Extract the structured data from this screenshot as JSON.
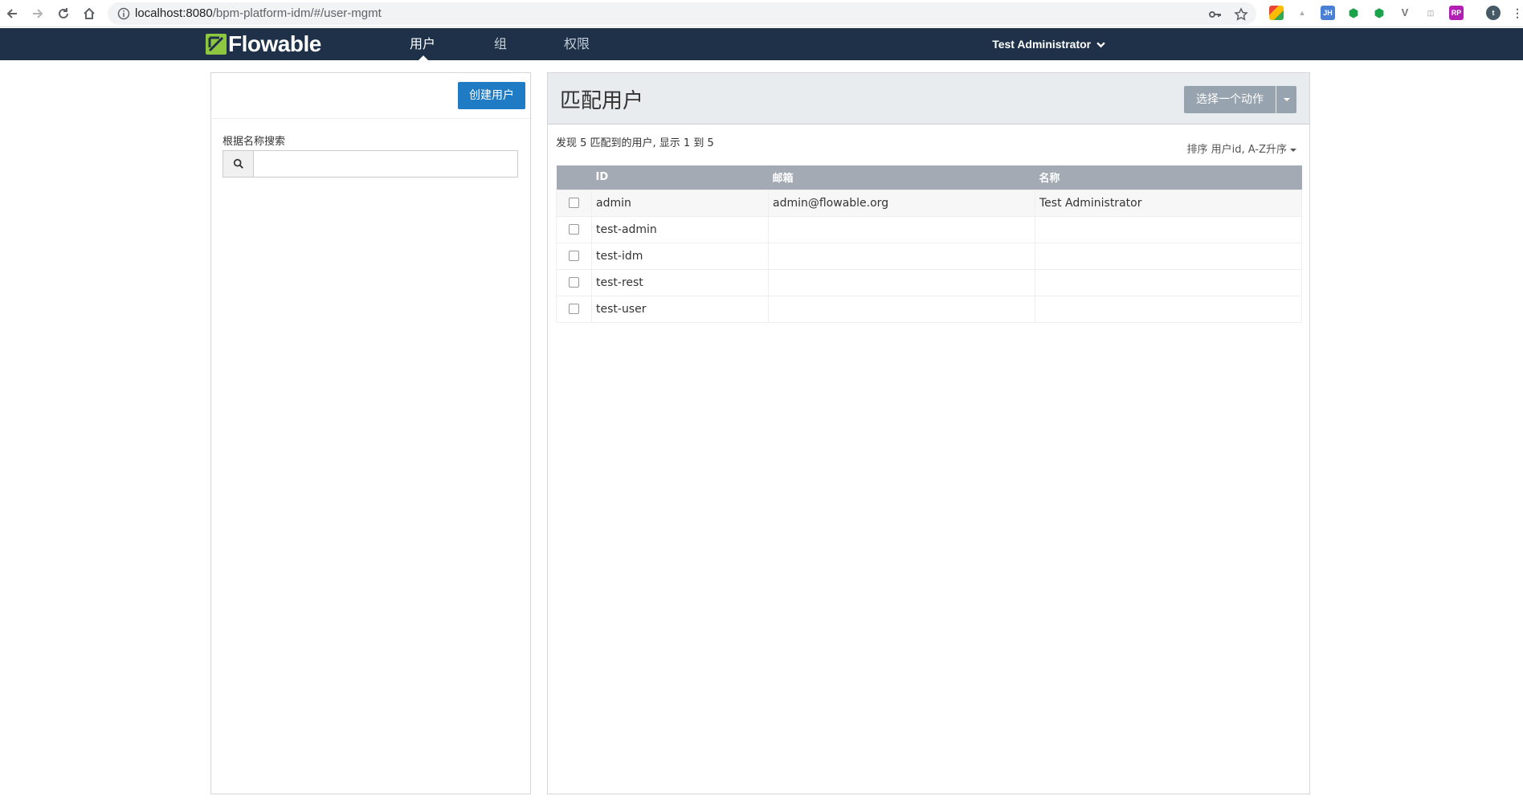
{
  "browser": {
    "url_host": "localhost:8080",
    "url_path": "/bpm-platform-idm/#/user-mgmt"
  },
  "app": {
    "logo_text": "Flowable",
    "nav": [
      {
        "label": "用户",
        "active": true
      },
      {
        "label": "组",
        "active": false
      },
      {
        "label": "权限",
        "active": false
      }
    ],
    "user_menu": "Test Administrator"
  },
  "left": {
    "create_button": "创建用户",
    "search_label": "根据名称搜索",
    "search_value": ""
  },
  "main": {
    "title": "匹配用户",
    "action_button": "选择一个动作",
    "summary": "发现 5 匹配到的用户, 显示 1 到 5",
    "sort_label": "排序 用户id, A-Z升序",
    "table": {
      "headers": [
        "ID",
        "邮箱",
        "名称"
      ],
      "rows": [
        {
          "id": "admin",
          "email": "admin@flowable.org",
          "name": "Test Administrator"
        },
        {
          "id": "test-admin",
          "email": "",
          "name": ""
        },
        {
          "id": "test-idm",
          "email": "",
          "name": ""
        },
        {
          "id": "test-rest",
          "email": "",
          "name": ""
        },
        {
          "id": "test-user",
          "email": "",
          "name": ""
        }
      ]
    }
  },
  "colors": {
    "navbar": "#1e3148",
    "primary_button": "#1e7bc4",
    "action_button": "#97a3ae",
    "table_header": "#a3aab3",
    "logo_green": "#8dc63f"
  }
}
